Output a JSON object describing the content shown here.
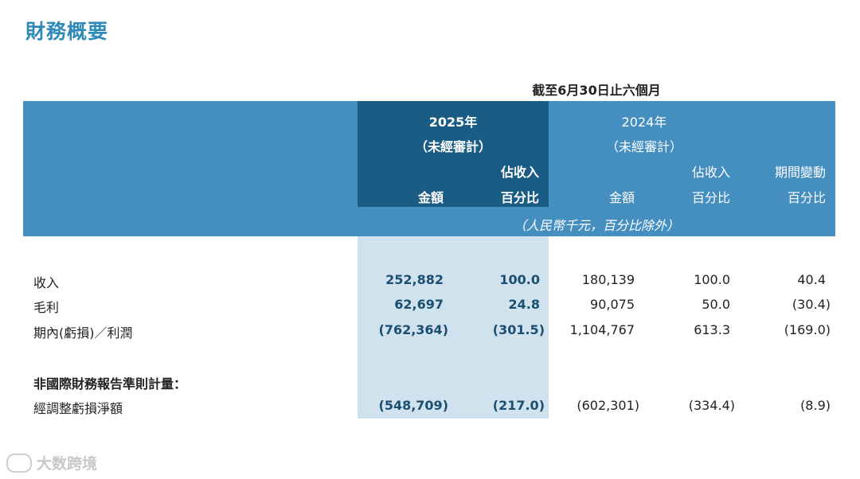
{
  "title": "財務概要",
  "period_header": "截至6月30日止六個月",
  "columns": {
    "y2025": {
      "year": "2025年",
      "audit": "（未經審計）",
      "amount": "金額",
      "pct_line1": "佔收入",
      "pct_line2": "百分比"
    },
    "y2024": {
      "year": "2024年",
      "audit": "（未經審計）",
      "amount": "金額",
      "pct_line1": "佔收入",
      "pct_line2": "百分比"
    },
    "change": {
      "line1": "期間變動",
      "line2": "百分比"
    }
  },
  "unit_note": "（人民幣千元，百分比除外）",
  "rows": [
    {
      "label": "收入",
      "a2025": "252,882",
      "p2025": "100.0",
      "a2024": "180,139",
      "p2024": "100.0",
      "chg": "40.4"
    },
    {
      "label": "毛利",
      "a2025": "62,697",
      "p2025": "24.8",
      "a2024": "90,075",
      "p2024": "50.0",
      "chg": "(30.4)"
    },
    {
      "label": "期內(虧損)／利潤",
      "a2025": "(762,364)",
      "p2025": "(301.5)",
      "a2024": "1,104,767",
      "p2024": "613.3",
      "chg": "(169.0)"
    }
  ],
  "section_heading": "非國際財務報告準則計量：",
  "non_ifrs_rows": [
    {
      "label": "經調整虧損淨額",
      "a2025": "(548,709)",
      "p2025": "(217.0)",
      "a2024": "(602,301)",
      "p2024": "(334.4)",
      "chg": "(8.9)"
    }
  ],
  "watermark": "大数跨境",
  "colors": {
    "title": "#2f8ab8",
    "header_band": "#448fc0",
    "header_2025": "#1b5c84",
    "body_2025": "#cfe2ee"
  }
}
